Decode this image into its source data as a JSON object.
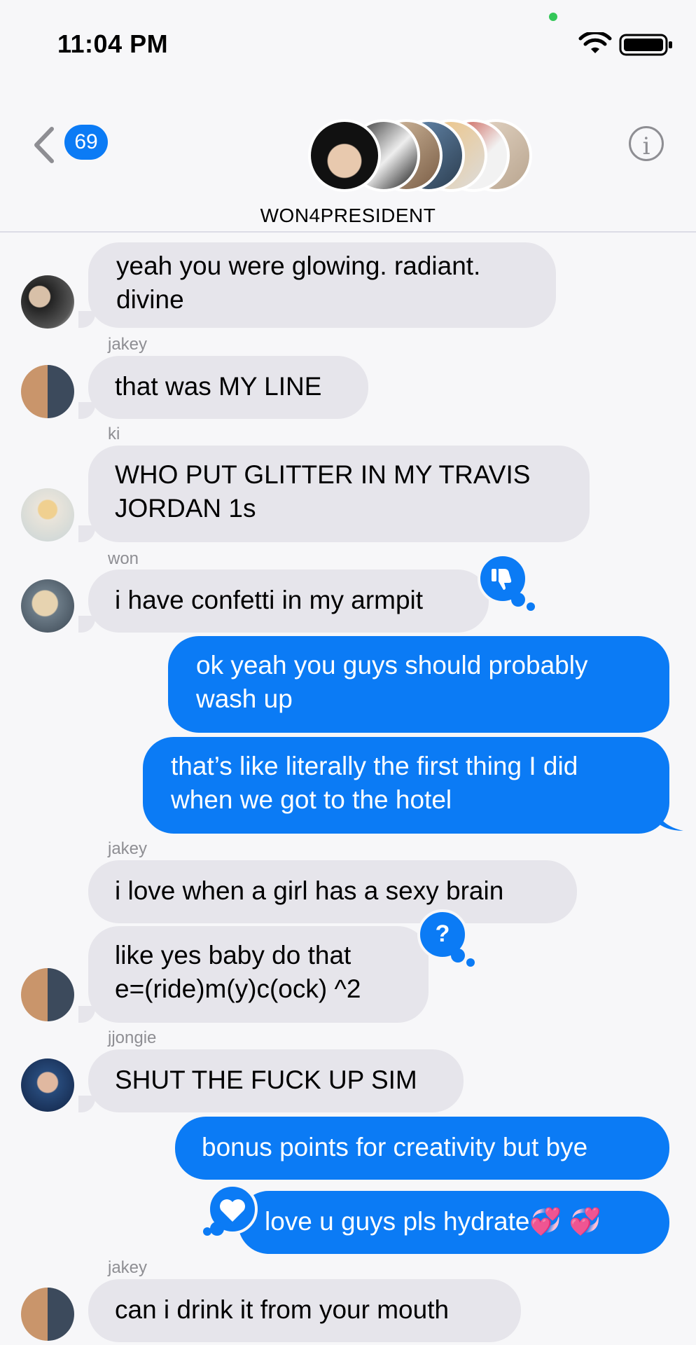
{
  "status": {
    "time": "11:04 PM"
  },
  "header": {
    "unread_badge": "69",
    "group_name": "WON4PRESIDENT",
    "info_label": "i"
  },
  "messages": [
    {
      "type": "in",
      "text_lines": [
        "yeah you were glowing. radiant.",
        "divine"
      ]
    },
    {
      "type": "in",
      "sender": "jakey",
      "text_lines": [
        "that was MY LINE"
      ]
    },
    {
      "type": "in",
      "sender": "ki",
      "text_lines": [
        "WHO PUT GLITTER IN MY TRAVIS",
        "JORDAN 1s"
      ]
    },
    {
      "type": "in",
      "sender": "won",
      "text_lines": [
        "i have confetti in my armpit"
      ],
      "reaction": "thumbs-down"
    },
    {
      "type": "out",
      "text_lines": [
        "ok yeah you guys should probably",
        "wash up"
      ]
    },
    {
      "type": "out",
      "text_lines": [
        "that’s like literally the first thing I did",
        "when we got to the hotel"
      ]
    },
    {
      "type": "in",
      "sender": "jakey",
      "text_lines": [
        "i love when a girl has a sexy brain"
      ]
    },
    {
      "type": "in",
      "text_lines": [
        "like yes baby do that",
        "e=(ride)m(y)c(ock) ^2"
      ],
      "reaction": "?"
    },
    {
      "type": "in",
      "sender": "jjongie",
      "text_lines": [
        "SHUT THE FUCK UP SIM"
      ]
    },
    {
      "type": "out",
      "text_lines": [
        "bonus points for creativity but bye"
      ]
    },
    {
      "type": "out",
      "text_lines": [
        "love u guys pls hydrate💞 💞"
      ],
      "reaction": "heart"
    },
    {
      "type": "in",
      "sender": "jakey",
      "text_lines": [
        "can i drink it from your mouth"
      ]
    }
  ]
}
